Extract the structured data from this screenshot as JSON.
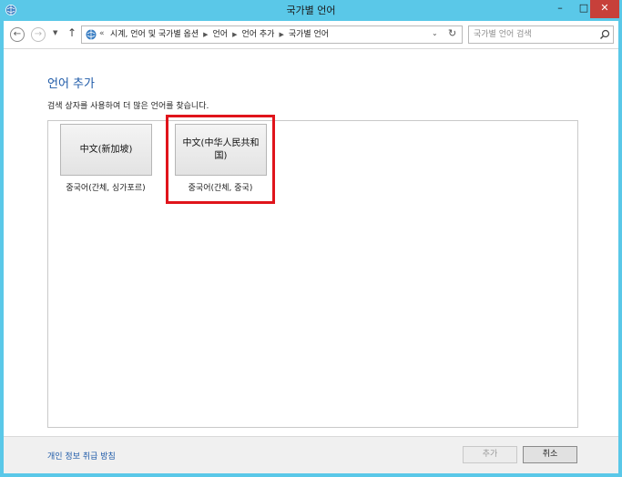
{
  "window": {
    "title": "국가별 언어",
    "controls": {
      "minimize": "–",
      "maximize": "□",
      "close": "✕"
    }
  },
  "navigation": {
    "back_icon": "back-arrow-icon",
    "forward_icon": "forward-arrow-icon",
    "up_icon": "up-arrow-icon",
    "breadcrumb_overflow": "«",
    "breadcrumbs": [
      "시계, 언어 및 국가별 옵션",
      "언어",
      "언어 추가",
      "국가별 언어"
    ],
    "search_placeholder": "국가별 언어 검색"
  },
  "main": {
    "heading": "언어 추가",
    "description": "검색 상자를 사용하여 더 많은 언어를 찾습니다.",
    "languages": [
      {
        "native_name": "中文(新加坡)",
        "caption": "중국어(간체, 싱가포르)"
      },
      {
        "native_name": "中文(中华人民共和国)",
        "caption": "중국어(간체, 중국)"
      }
    ]
  },
  "footer": {
    "privacy_link": "개인 정보 취급 방침",
    "add_button": "추가",
    "cancel_button": "취소"
  },
  "colors": {
    "titlebar": "#5ac8e8",
    "accent_link": "#1e5aa8",
    "highlight": "#e0141b",
    "close_button": "#c7403a"
  }
}
